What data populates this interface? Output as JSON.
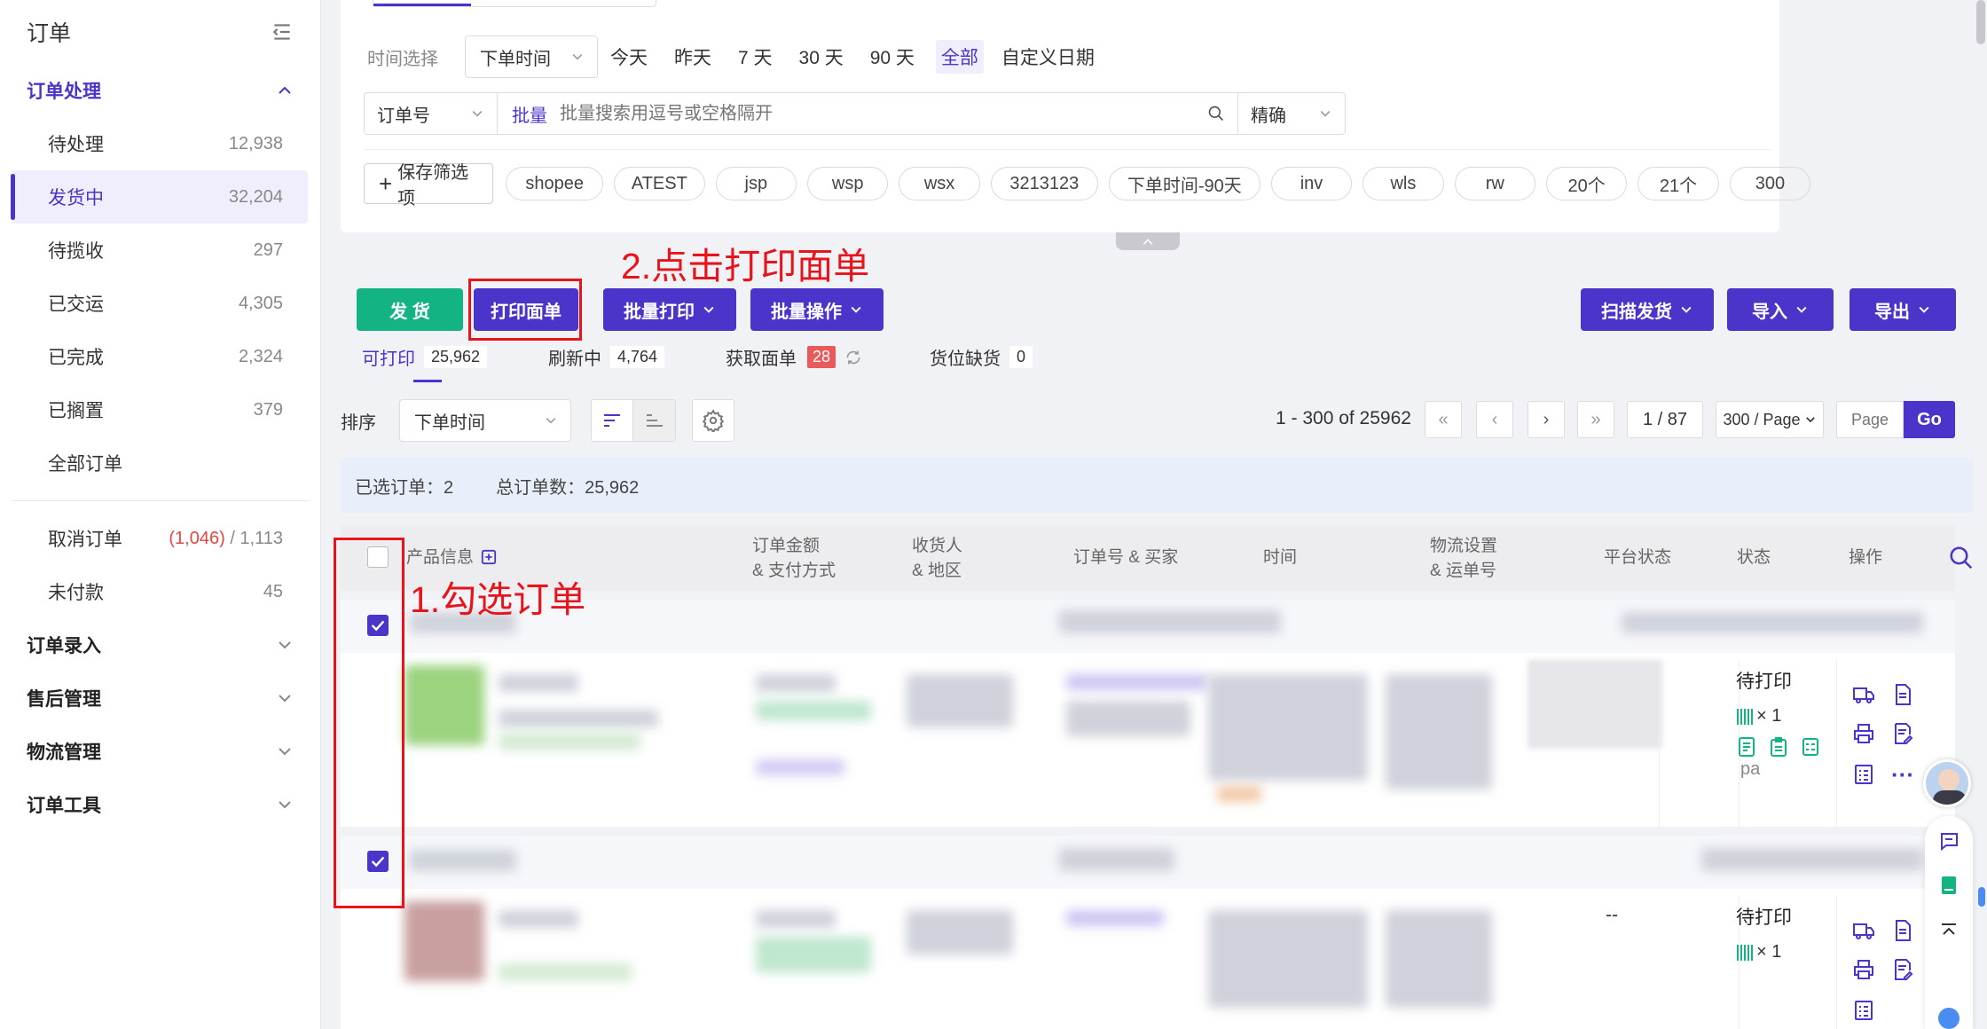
{
  "sidebar": {
    "title": "订单",
    "group_process": "订单处理",
    "items": [
      {
        "label": "待处理",
        "count": "12,938"
      },
      {
        "label": "发货中",
        "count": "32,204"
      },
      {
        "label": "待揽收",
        "count": "297"
      },
      {
        "label": "已交运",
        "count": "4,305"
      },
      {
        "label": "已完成",
        "count": "2,324"
      },
      {
        "label": "已搁置",
        "count": "379"
      },
      {
        "label": "全部订单",
        "count": ""
      }
    ],
    "cancel": {
      "label": "取消订单",
      "red": "(1,046)",
      "rest": " / 1,113"
    },
    "unpaid": {
      "label": "未付款",
      "count": "45"
    },
    "groups": [
      "订单录入",
      "售后管理",
      "物流管理",
      "订单工具"
    ]
  },
  "filter": {
    "time_label": "时间选择",
    "time_field": "下单时间",
    "time_opts": [
      "今天",
      "昨天",
      "7 天",
      "30 天",
      "90 天",
      "全部",
      "自定义日期"
    ],
    "order_field": "订单号",
    "batch": "批量",
    "search_placeholder": "批量搜索用逗号或空格隔开",
    "match": "精确",
    "save": "保存筛选项",
    "tags": [
      "shopee",
      "ATEST",
      "jsp",
      "wsp",
      "wsx",
      "3213123",
      "下单时间-90天",
      "inv",
      "wls",
      "rw",
      "20个",
      "21个",
      "300"
    ]
  },
  "actions": {
    "ship": "发 货",
    "print_label": "打印面单",
    "batch_print": "批量打印",
    "batch_ops": "批量操作",
    "scan_ship": "扫描发货",
    "import": "导入",
    "export": "导出"
  },
  "annotations": {
    "step1": "1.勾选订单",
    "step2": "2.点击打印面单"
  },
  "subtabs": [
    {
      "label": "可打印",
      "num": "25,962"
    },
    {
      "label": "刷新中",
      "num": "4,764"
    },
    {
      "label": "获取面单",
      "num": "28"
    },
    {
      "label": "货位缺货",
      "num": "0"
    }
  ],
  "sort": {
    "label": "排序",
    "field": "下单时间"
  },
  "pagination": {
    "range": "1 - 300 of 25962",
    "page": "1 / 87",
    "per_page": "300 / Page",
    "page_placeholder": "Page",
    "go": "Go"
  },
  "info": {
    "selected": "已选订单：2",
    "total": "总订单数：25,962"
  },
  "table": {
    "headers": [
      "产品信息",
      "订单金额\n& 支付方式",
      "收货人\n& 地区",
      "订单号 & 买家",
      "时间",
      "物流设置\n& 运单号",
      "平台状态",
      "状态",
      "操作"
    ],
    "rows": [
      {
        "status": "待打印",
        "qty": "× 1",
        "platform": ""
      },
      {
        "status": "待打印",
        "qty": "× 1",
        "platform": "--"
      }
    ],
    "partial_text": "pa"
  }
}
